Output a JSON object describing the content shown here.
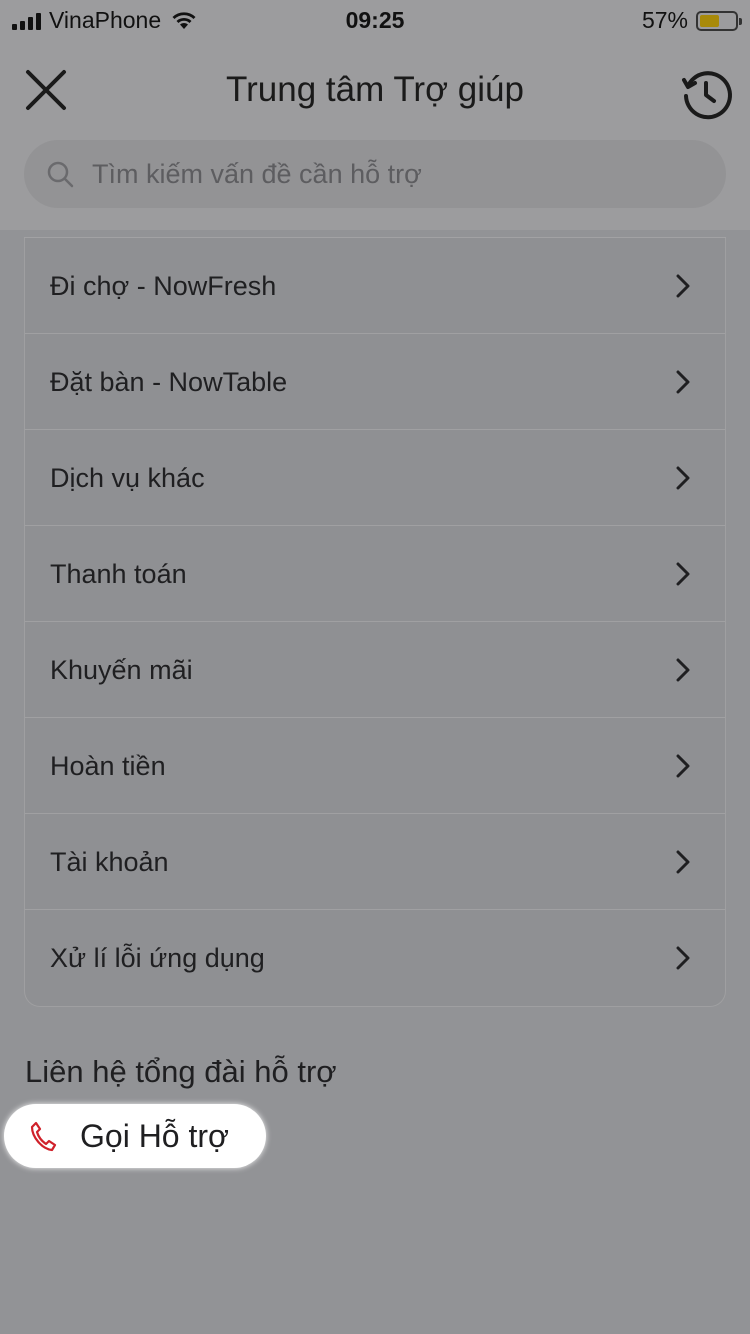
{
  "status_bar": {
    "carrier": "VinaPhone",
    "time": "09:25",
    "battery": "57%",
    "battery_level": 0.57
  },
  "header": {
    "title": "Trung tâm Trợ giúp",
    "close_icon": "close-icon",
    "history_icon": "history-icon"
  },
  "search": {
    "placeholder": "Tìm kiếm vấn đề cần hỗ trợ",
    "value": ""
  },
  "topics": [
    {
      "label": "Đi chợ - NowFresh"
    },
    {
      "label": "Đặt bàn - NowTable"
    },
    {
      "label": "Dịch vụ khác"
    },
    {
      "label": "Thanh toán"
    },
    {
      "label": "Khuyến mãi"
    },
    {
      "label": "Hoàn tiền"
    },
    {
      "label": "Tài khoản"
    },
    {
      "label": "Xử lí lỗi ứng dụng"
    }
  ],
  "contact": {
    "title": "Liên hệ tổng đài hỗ trợ",
    "call_label": "Gọi Hỗ trợ",
    "phone_icon_color": "#d0212a"
  },
  "colors": {
    "overlay_background": "#929396",
    "call_button_background": "#ffffff"
  }
}
